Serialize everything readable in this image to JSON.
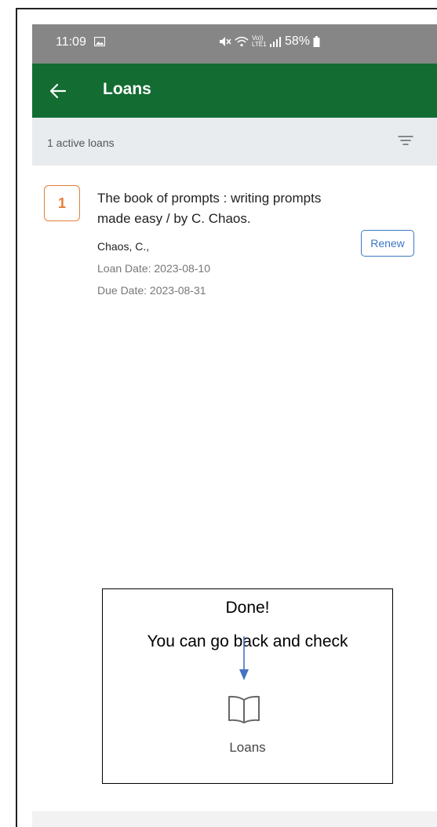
{
  "status_bar": {
    "time": "11:09",
    "network_text": "Vo)) LTE1",
    "battery": "58%",
    "icons": [
      "photo-icon",
      "mute-icon",
      "wifi-icon",
      "signal-icon",
      "battery-icon"
    ]
  },
  "app_bar": {
    "title": "Loans",
    "color": "#136c32"
  },
  "summary": {
    "text": "1 active loans"
  },
  "loan": {
    "number": "1",
    "title": "The book of prompts : writing prompts made easy / by C. Chaos.",
    "author": "Chaos, C.,",
    "loan_date": "Loan Date: 2023-08-10",
    "due_date": "Due Date: 2023-08-31",
    "renew_label": "Renew"
  },
  "callout": {
    "title": "Done!",
    "text": "You can go back and check",
    "icon": "book-icon",
    "icon_label": "Loans",
    "arrow_color": "#4472c4"
  }
}
